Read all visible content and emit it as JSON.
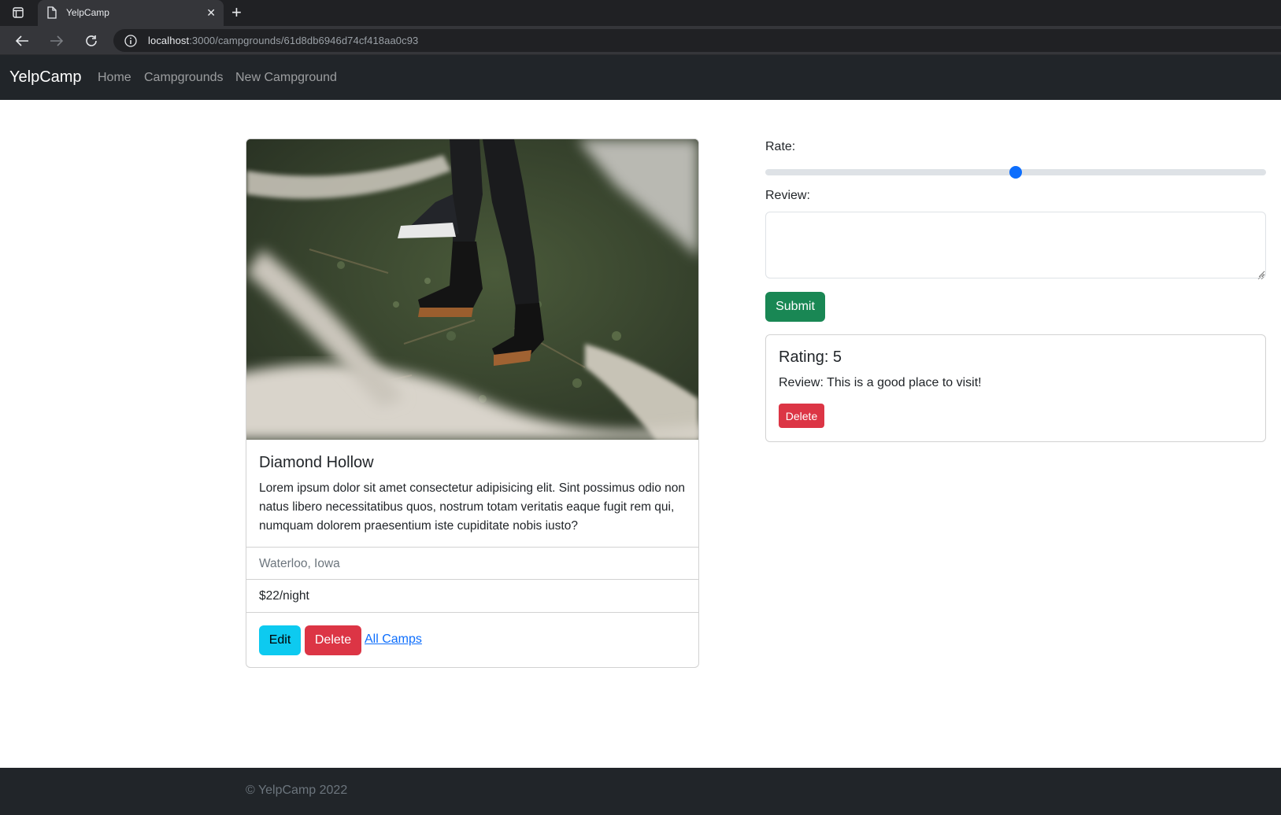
{
  "browser": {
    "tab_title": "YelpCamp",
    "url_host": "localhost",
    "url_path": ":3000/campgrounds/61d8db6946d74cf418aa0c93"
  },
  "navbar": {
    "brand": "YelpCamp",
    "links": [
      "Home",
      "Campgrounds",
      "New Campground"
    ]
  },
  "campground": {
    "title": "Diamond Hollow",
    "description": "Lorem ipsum dolor sit amet consectetur adipisicing elit. Sint possimus odio non natus libero necessitatibus quos, nostrum totam veritatis eaque fugit rem qui, numquam dolorem praesentium iste cupiditate nobis iusto?",
    "location": "Waterloo, Iowa",
    "price": "$22/night",
    "edit_label": "Edit",
    "delete_label": "Delete",
    "all_camps_label": "All Camps"
  },
  "review_form": {
    "rate_label": "Rate:",
    "rate_value": 3,
    "rate_min": 1,
    "rate_max": 5,
    "review_label": "Review:",
    "review_value": "",
    "submit_label": "Submit"
  },
  "reviews": [
    {
      "rating_text": "Rating: 5",
      "review_text": "Review: This is a good place to visit!",
      "delete_label": "Delete"
    }
  ],
  "footer": {
    "text": "© YelpCamp 2022"
  },
  "colors": {
    "navbar_bg": "#212529",
    "info": "#0dcaf0",
    "danger": "#dc3545",
    "success": "#198754",
    "primary": "#0d6efd"
  }
}
